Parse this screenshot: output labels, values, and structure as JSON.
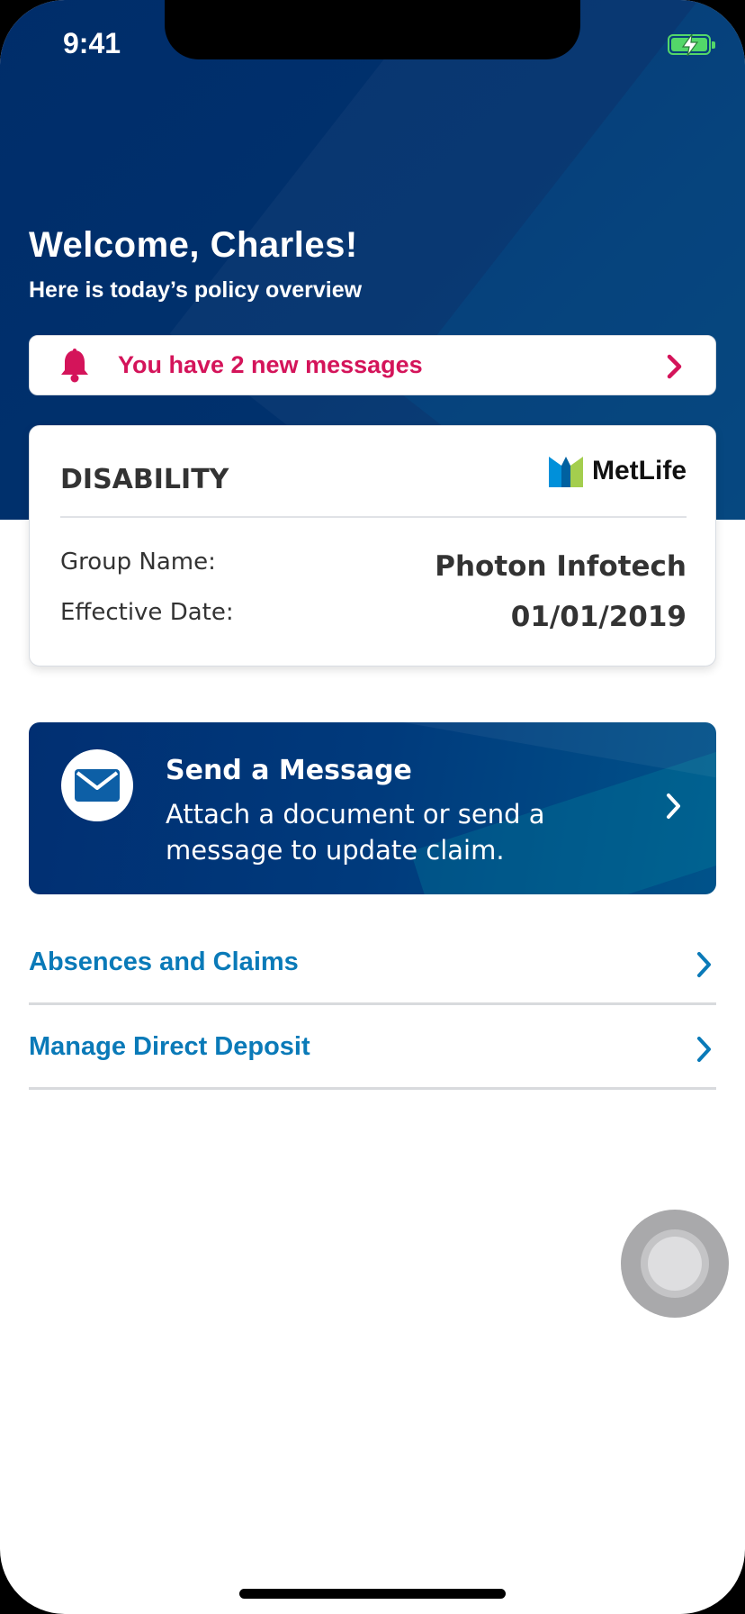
{
  "status_bar": {
    "time": "9:41"
  },
  "header": {
    "welcome": "Welcome, Charles!",
    "subtitle": "Here is today’s policy overview"
  },
  "messages_banner": {
    "text": "You have 2 new messages"
  },
  "policy": {
    "type": "DISABILITY",
    "brand": "MetLife",
    "group_name_label": "Group Name:",
    "group_name_value": "Photon Infotech",
    "effective_date_label": "Effective Date:",
    "effective_date_value": "01/01/2019"
  },
  "send_message": {
    "title": "Send a Message",
    "description": "Attach a document or send a message to update claim."
  },
  "links": [
    {
      "label": "Absences and Claims"
    },
    {
      "label": "Manage Direct Deposit"
    }
  ],
  "colors": {
    "header_bg": "#00316d",
    "alert_pink": "#d4145a",
    "link_blue": "#0a7ab8",
    "battery_green": "#53d769",
    "metlife_blue": "#0090da",
    "metlife_green": "#a4ce4e"
  },
  "icons": [
    "battery-icon",
    "bell-icon",
    "chevron-right-icon",
    "mail-icon",
    "metlife-logo-icon",
    "assistive-touch-icon"
  ]
}
